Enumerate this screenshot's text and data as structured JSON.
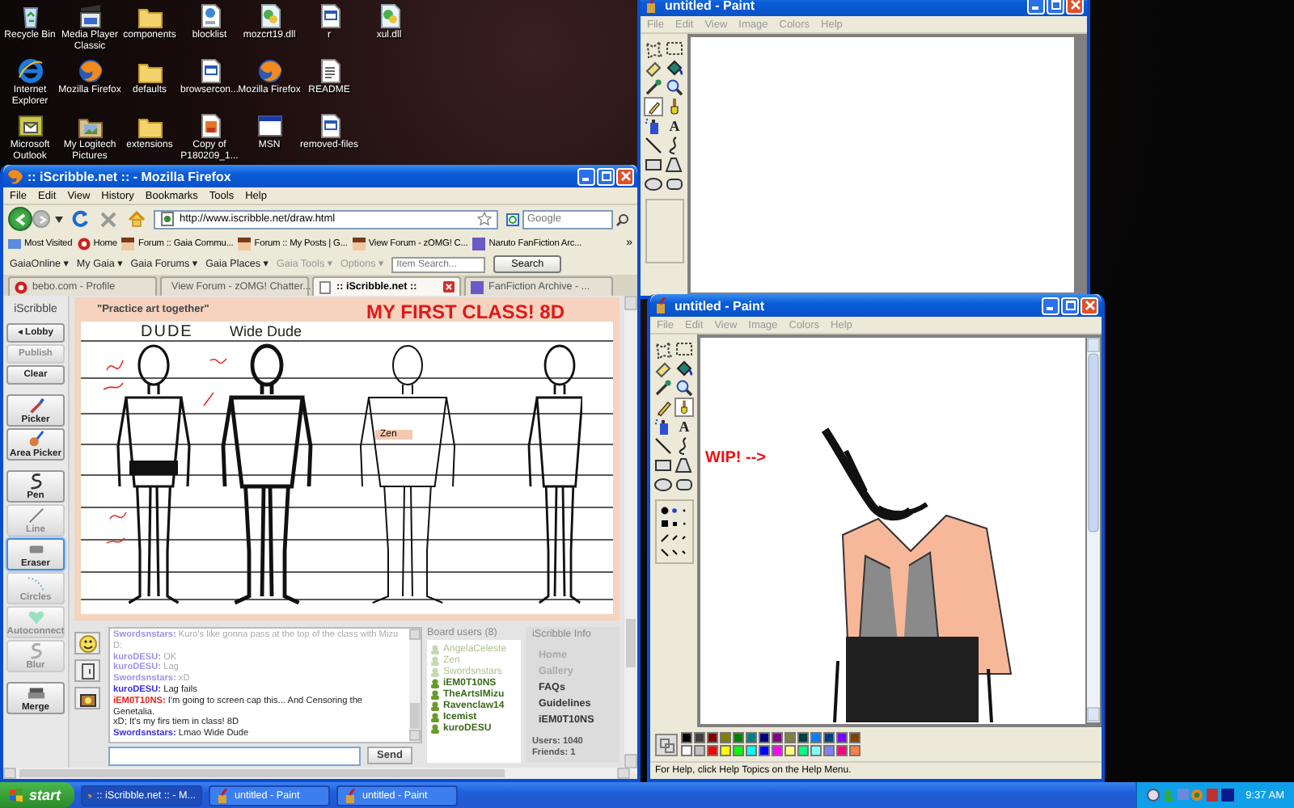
{
  "desktop": {
    "icon_rows": [
      [
        {
          "label": "Recycle Bin",
          "kind": "recycle-bin"
        },
        {
          "label": "Media Player Classic",
          "kind": "media-player"
        },
        {
          "label": "components",
          "kind": "folder"
        },
        {
          "label": "blocklist",
          "kind": "web-file"
        },
        {
          "label": "mozcrt19.dll",
          "kind": "gear-file"
        },
        {
          "label": "r",
          "kind": "window-file"
        },
        {
          "label": "xul.dll",
          "kind": "gear-file"
        }
      ],
      [
        {
          "label": "Internet Explorer",
          "kind": "ie"
        },
        {
          "label": "Mozilla Firefox",
          "kind": "firefox"
        },
        {
          "label": "defaults",
          "kind": "folder"
        },
        {
          "label": "browsercon...",
          "kind": "window-file"
        },
        {
          "label": "Mozilla Firefox",
          "kind": "firefox"
        },
        {
          "label": "README",
          "kind": "text-file"
        }
      ],
      [
        {
          "label": "Microsoft Outlook",
          "kind": "outlook"
        },
        {
          "label": "My Logitech Pictures",
          "kind": "pictures"
        },
        {
          "label": "extensions",
          "kind": "folder"
        },
        {
          "label": "Copy of P180209_1...",
          "kind": "image-file"
        },
        {
          "label": "MSN",
          "kind": "msn-window"
        },
        {
          "label": "removed-files",
          "kind": "window-file"
        }
      ]
    ]
  },
  "firefox": {
    "title": ":: iScribble.net :: - Mozilla Firefox",
    "menu": [
      "File",
      "Edit",
      "View",
      "History",
      "Bookmarks",
      "Tools",
      "Help"
    ],
    "url": "http://www.iscribble.net/draw.html",
    "search_placeholder": "Google",
    "bookmarks": [
      "Most Visited",
      "Home",
      "Forum :: Gaia Commu...",
      "Forum :: My Posts | G...",
      "View Forum - zOMG! C...",
      "Naruto FanFiction Arc..."
    ],
    "bookmarks_more": "»",
    "gaia_toolbar": {
      "menus": [
        {
          "label": "GaiaOnline ▾",
          "disabled": false
        },
        {
          "label": "My Gaia ▾",
          "disabled": false
        },
        {
          "label": "Gaia Forums ▾",
          "disabled": false
        },
        {
          "label": "Gaia Places ▾",
          "disabled": false
        },
        {
          "label": "Gaia Tools ▾",
          "disabled": true
        },
        {
          "label": "Options ▾",
          "disabled": true
        }
      ],
      "search_placeholder": "Item Search...",
      "search_button": "Search"
    },
    "tabs": [
      {
        "label": "bebo.com - Profile",
        "selected": false
      },
      {
        "label": "View Forum - zOMG! Chatter...",
        "selected": false
      },
      {
        "label": ":: iScribble.net ::",
        "selected": true
      },
      {
        "label": "FanFiction Archive - ...",
        "selected": false
      }
    ],
    "iscribble": {
      "logo": "iScribble",
      "tools": [
        {
          "label": "◂ Lobby",
          "kind": "text",
          "disabled": false,
          "selected": false
        },
        {
          "label": "Publish",
          "kind": "text",
          "disabled": true,
          "selected": false
        },
        {
          "label": "Clear",
          "kind": "text",
          "disabled": false,
          "selected": false
        },
        {
          "label": "Picker",
          "kind": "picker",
          "disabled": false,
          "selected": false
        },
        {
          "label": "Area Picker",
          "kind": "area-picker",
          "disabled": false,
          "selected": false
        },
        {
          "label": "Pen",
          "kind": "pen",
          "disabled": false,
          "selected": false
        },
        {
          "label": "Line",
          "kind": "line",
          "disabled": true,
          "selected": false
        },
        {
          "label": "Eraser",
          "kind": "eraser",
          "disabled": false,
          "selected": true
        },
        {
          "label": "Circles",
          "kind": "circles",
          "disabled": true,
          "selected": false
        },
        {
          "label": "Autoconnect",
          "kind": "autoconnect",
          "disabled": true,
          "selected": false
        },
        {
          "label": "Blur",
          "kind": "blur",
          "disabled": true,
          "selected": false
        },
        {
          "label": "Merge",
          "kind": "merge",
          "disabled": false,
          "selected": false
        }
      ],
      "tagline": "\"Practice art together\"",
      "board_title": "MY FIRST CLASS! 8D",
      "sketch_labels": [
        "DUDE",
        "Wide Dude"
      ],
      "cursor_tag": "Zen",
      "chat": {
        "messages": [
          {
            "user": "Swordsnstars:",
            "text": "Kuro's like gonna pass at the top of the class with Mizu D:",
            "color": "#9c94e8",
            "faded": true
          },
          {
            "user": "kuroDESU:",
            "text": "OK",
            "color": "#9c94e8",
            "faded": true
          },
          {
            "user": "kuroDESU:",
            "text": "Lag",
            "color": "#9c94e8",
            "faded": true
          },
          {
            "user": "Swordsnstars:",
            "text": "xD",
            "color": "#9c94e8",
            "faded": true
          },
          {
            "user": "kuroDESU:",
            "text": "Lag fails",
            "color": "#3a2ee0",
            "faded": false
          },
          {
            "user": "iEM0T10NS:",
            "text": "I'm going to screen cap this... And Censoring the Genetalia.",
            "color": "#e02020",
            "faded": false
          },
          {
            "text": "xD; It's my firs tiem in class! 8D",
            "faded": false
          },
          {
            "user": "Swordsnstars:",
            "text": "Lmao Wide Dude",
            "color": "#3a2ee0",
            "faded": false
          }
        ],
        "send": "Send"
      },
      "board_users": {
        "title": "Board users (8)",
        "users": [
          {
            "name": "AngelaCeleste",
            "away": true
          },
          {
            "name": "Zen",
            "away": true
          },
          {
            "name": "Swordsnstars",
            "away": true
          },
          {
            "name": "iEM0T10NS",
            "away": false
          },
          {
            "name": "TheArtsIMizu",
            "away": false
          },
          {
            "name": "Ravenclaw14",
            "away": false
          },
          {
            "name": "Icemist",
            "away": false
          },
          {
            "name": "kuroDESU",
            "away": false
          }
        ]
      },
      "info": {
        "title": "iScribble Info",
        "links": [
          {
            "label": "Home",
            "faded": true
          },
          {
            "label": "Gallery",
            "faded": true
          },
          {
            "label": "FAQs",
            "faded": false
          },
          {
            "label": "Guidelines",
            "faded": false
          },
          {
            "label": "iEM0T10NS",
            "faded": false
          }
        ],
        "stats": "Users: 1040 Friends: 1"
      }
    }
  },
  "paint_back": {
    "title": "untitled - Paint",
    "menu": [
      "File",
      "Edit",
      "View",
      "Image",
      "Colors",
      "Help"
    ],
    "tools": [
      {
        "kind": "free-select",
        "selected": false
      },
      {
        "kind": "select",
        "selected": false
      },
      {
        "kind": "eraser",
        "selected": false
      },
      {
        "kind": "fill",
        "selected": false
      },
      {
        "kind": "picker",
        "selected": false
      },
      {
        "kind": "magnifier",
        "selected": false
      },
      {
        "kind": "pencil",
        "selected": true
      },
      {
        "kind": "brush",
        "selected": false
      },
      {
        "kind": "airbrush",
        "selected": false
      },
      {
        "kind": "text",
        "glyph": "A",
        "selected": false
      },
      {
        "kind": "line",
        "selected": false
      },
      {
        "kind": "curve",
        "selected": false
      },
      {
        "kind": "rectangle",
        "selected": false
      },
      {
        "kind": "polygon",
        "selected": false
      },
      {
        "kind": "ellipse",
        "selected": false
      },
      {
        "kind": "rounded-rectangle",
        "selected": false
      }
    ]
  },
  "paint_front": {
    "title": "untitled - Paint",
    "menu": [
      "File",
      "Edit",
      "View",
      "Image",
      "Colors",
      "Help"
    ],
    "tools": [
      {
        "kind": "free-select",
        "selected": false
      },
      {
        "kind": "select",
        "selected": false
      },
      {
        "kind": "eraser",
        "selected": false
      },
      {
        "kind": "fill",
        "selected": false
      },
      {
        "kind": "picker",
        "selected": false
      },
      {
        "kind": "magnifier",
        "selected": false
      },
      {
        "kind": "pencil",
        "selected": false
      },
      {
        "kind": "brush",
        "selected": true
      },
      {
        "kind": "airbrush",
        "selected": false
      },
      {
        "kind": "text",
        "glyph": "A",
        "selected": false
      },
      {
        "kind": "line",
        "selected": false
      },
      {
        "kind": "curve",
        "selected": false
      },
      {
        "kind": "rectangle",
        "selected": false
      },
      {
        "kind": "polygon",
        "selected": false
      },
      {
        "kind": "ellipse",
        "selected": false
      },
      {
        "kind": "rounded-rectangle",
        "selected": false
      }
    ],
    "canvas_text": "WIP! -->",
    "palette": [
      {
        "color": "#000000"
      },
      {
        "color": "#404040"
      },
      {
        "color": "#800000"
      },
      {
        "color": "#808000"
      },
      {
        "color": "#008000"
      },
      {
        "color": "#008080"
      },
      {
        "color": "#000080"
      },
      {
        "color": "#800080"
      },
      {
        "color": "#808040"
      },
      {
        "color": "#004040"
      },
      {
        "color": "#0080ff"
      },
      {
        "color": "#004080"
      },
      {
        "color": "#8000ff"
      },
      {
        "color": "#804000"
      },
      {
        "color": "#ffffff"
      },
      {
        "color": "#c0c0c0"
      },
      {
        "color": "#ff0000"
      },
      {
        "color": "#ffff00"
      },
      {
        "color": "#00ff00"
      },
      {
        "color": "#00ffff"
      },
      {
        "color": "#0000ff"
      },
      {
        "color": "#ff00ff"
      },
      {
        "color": "#ffff80"
      },
      {
        "color": "#00ff80"
      },
      {
        "color": "#80ffff"
      },
      {
        "color": "#8080ff"
      },
      {
        "color": "#ff0080"
      },
      {
        "color": "#ff8040"
      }
    ],
    "status": "For Help, click Help Topics on the Help Menu."
  },
  "taskbar": {
    "start": "start",
    "tasks": [
      {
        "label": ":: iScribble.net :: - M...",
        "selected": true
      },
      {
        "label": "untitled - Paint",
        "selected": false
      },
      {
        "label": "untitled - Paint",
        "selected": false
      }
    ],
    "clock": "9:37 AM"
  }
}
